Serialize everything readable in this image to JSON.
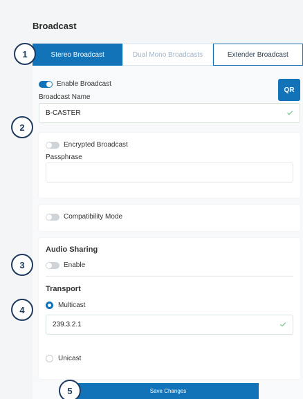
{
  "page": {
    "title": "Broadcast"
  },
  "tabs": [
    {
      "label": "Stereo Broadcast"
    },
    {
      "label": "Dual Mono Broadcasts"
    },
    {
      "label": "Extender Broadcast"
    }
  ],
  "broadcast": {
    "enable_label": "Enable Broadcast",
    "enabled": true,
    "name_label": "Broadcast Name",
    "name_value": "B-CASTER",
    "qr_label": "QR"
  },
  "encryption": {
    "label": "Encrypted Broadcast",
    "enabled": false,
    "passphrase_label": "Passphrase",
    "passphrase_value": ""
  },
  "compatibility": {
    "label": "Compatibility Mode",
    "enabled": false
  },
  "audio_sharing": {
    "title": "Audio Sharing",
    "enable_label": "Enable",
    "enabled": false
  },
  "transport": {
    "title": "Transport",
    "multicast_label": "Multicast",
    "multicast_selected": true,
    "multicast_address": "239.3.2.1",
    "unicast_label": "Unicast"
  },
  "actions": {
    "save_label": "Save Changes"
  },
  "badges": [
    "1",
    "2",
    "3",
    "4",
    "5"
  ],
  "colors": {
    "accent": "#1273b8",
    "badge": "#1e3a5f",
    "valid": "#7cc38f"
  }
}
